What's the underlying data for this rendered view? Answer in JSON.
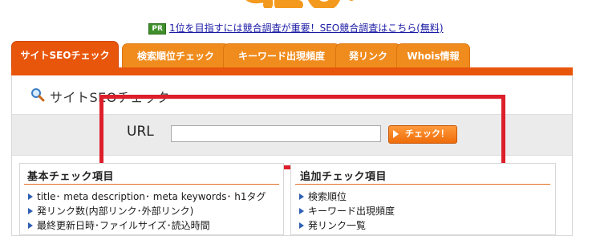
{
  "pr": {
    "badge": "PR",
    "link_text": "1位を目指すには競合調査が重要！SEO競合調査はこちら(無料)"
  },
  "tabs": [
    {
      "label": "サイトSEOチェック",
      "active": true
    },
    {
      "label": "検索順位チェック",
      "active": false
    },
    {
      "label": "キーワード出現頻度",
      "active": false
    },
    {
      "label": "発リンク",
      "active": false
    },
    {
      "label": "Whois情報",
      "active": false
    }
  ],
  "section": {
    "title": "サイトSEOチェック"
  },
  "form": {
    "url_label": "URL",
    "url_value": "",
    "check_label": "チェック！"
  },
  "basic": {
    "title": "基本チェック項目",
    "items": [
      "title･ meta description･ meta keywords･ h1タグ",
      "発リンク数(内部リンク･外部リンク)",
      "最終更新日時･ファイルサイズ･読込時間"
    ]
  },
  "extra": {
    "title": "追加チェック項目",
    "items": [
      "検索順位",
      "キーワード出現頻度",
      "発リンク一覧"
    ]
  },
  "colors": {
    "tab_active": "#e8560b",
    "tab": "#f08c1e",
    "highlight_frame": "#dd1f2b",
    "bullet": "#2e5fb3"
  }
}
